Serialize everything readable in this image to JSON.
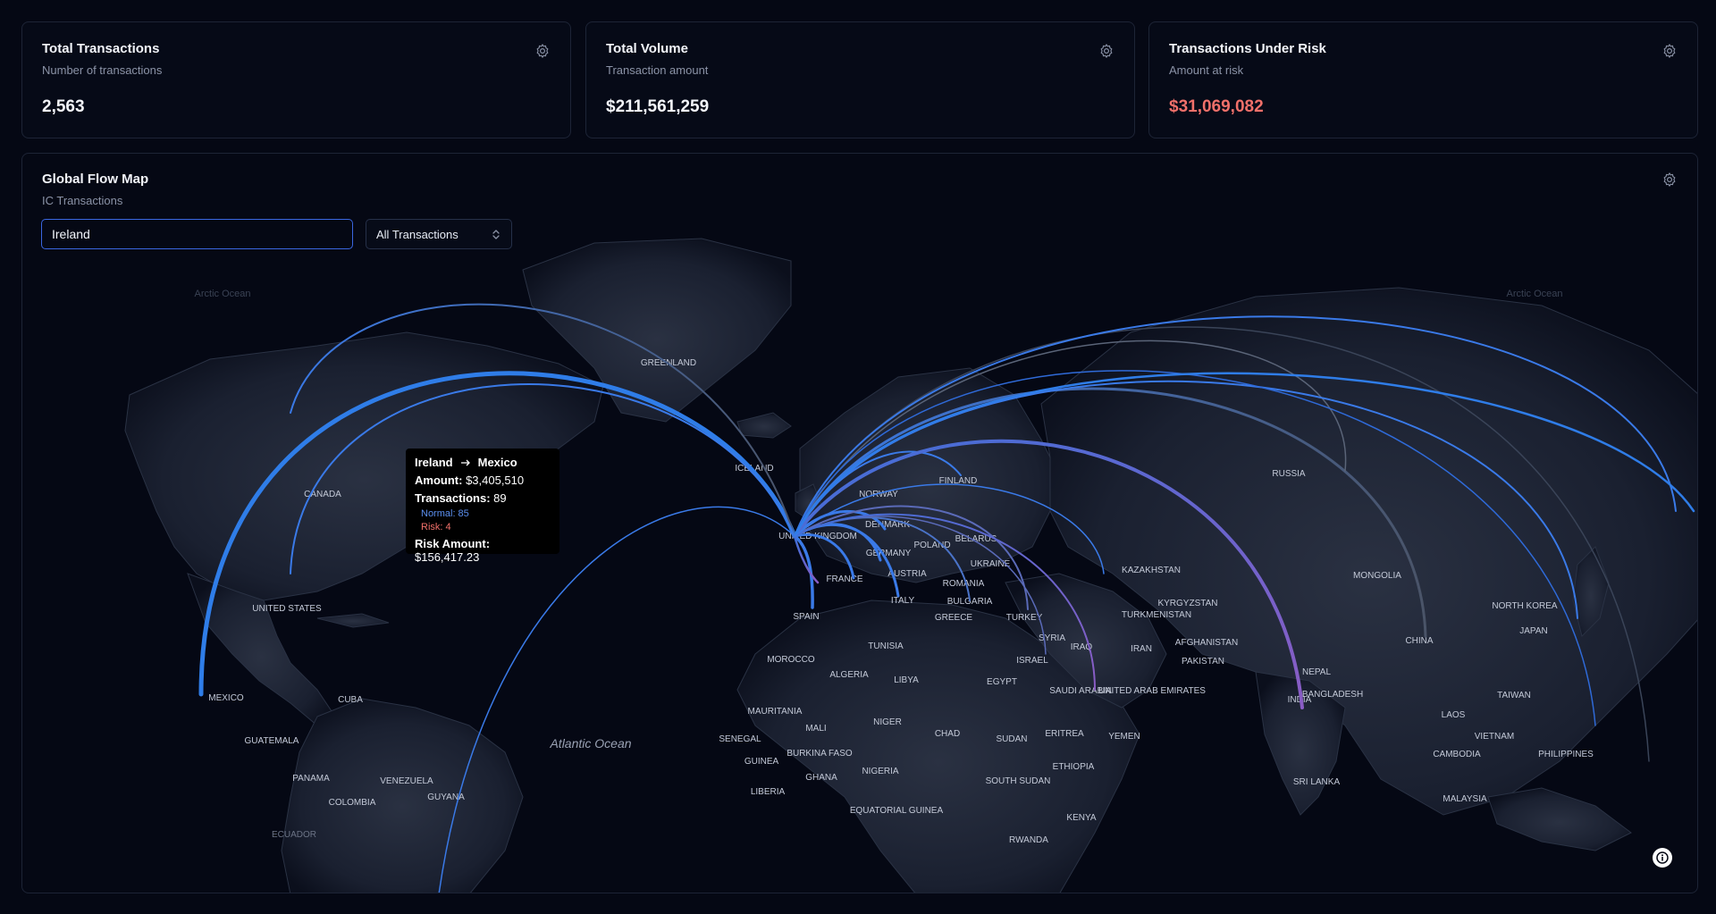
{
  "kpis": [
    {
      "title": "Total Transactions",
      "subtitle": "Number of transactions",
      "value": "2,563"
    },
    {
      "title": "Total Volume",
      "subtitle": "Transaction amount",
      "value": "$211,561,259"
    },
    {
      "title": "Transactions Under Risk",
      "subtitle": "Amount at risk",
      "value": "$31,069,082",
      "value_color": "#f0706a"
    }
  ],
  "map": {
    "title": "Global Flow Map",
    "subtitle": "IC Transactions",
    "search_value": "Ireland",
    "filter_selected": "All Transactions",
    "tooltip": {
      "from": "Ireland",
      "to": "Mexico",
      "amount_label": "Amount:",
      "amount": "$3,405,510",
      "transactions_label": "Transactions:",
      "transactions": "89",
      "normal": "Normal: 85",
      "risk": "Risk: 4",
      "risk_amount_label": "Risk Amount:",
      "risk_amount": "$156,417.23"
    },
    "colors": {
      "normal_flow": "#2f7de8",
      "risk_flow": "#8a5cc4",
      "accent": "#3a66e0"
    },
    "labels": [
      "GREENLAND",
      "ICELAND",
      "CANADA",
      "UNITED STATES",
      "MEXICO",
      "CUBA",
      "GUATEMALA",
      "PANAMA",
      "VENEZUELA",
      "GUYANA",
      "COLOMBIA",
      "ECUADOR",
      "Atlantic Ocean",
      "Arctic Ocean",
      "FINLAND",
      "NORWAY",
      "DENMARK",
      "UNITED KINGDOM",
      "GERMANY",
      "POLAND",
      "BELARUS",
      "UKRAINE",
      "FRANCE",
      "AUSTRIA",
      "ROMANIA",
      "BULGARIA",
      "ITALY",
      "SPAIN",
      "GREECE",
      "TURKEY",
      "MOROCCO",
      "TUNISIA",
      "ALGERIA",
      "LIBYA",
      "EGYPT",
      "SYRIA",
      "IRAQ",
      "ISRAEL",
      "SAUDI ARABIA",
      "IRAN",
      "UNITED ARAB EMIRATES",
      "YEMEN",
      "MAURITANIA",
      "MALI",
      "NIGER",
      "CHAD",
      "SUDAN",
      "ERITREA",
      "ETHIOPIA",
      "SENEGAL",
      "GUINEA",
      "BURKINA FASO",
      "GHANA",
      "NIGERIA",
      "LIBERIA",
      "EQUATORIAL GUINEA",
      "SOUTH SUDAN",
      "KENYA",
      "RWANDA",
      "RUSSIA",
      "KAZAKHSTAN",
      "MONGOLIA",
      "KYRGYZSTAN",
      "TURKMENISTAN",
      "AFGHANISTAN",
      "PAKISTAN",
      "NEPAL",
      "INDIA",
      "BANGLADESH",
      "CHINA",
      "NORTH KOREA",
      "JAPAN",
      "TAIWAN",
      "LAOS",
      "VIETNAM",
      "CAMBODIA",
      "PHILIPPINES",
      "MALAYSIA",
      "SRI LANKA"
    ]
  }
}
